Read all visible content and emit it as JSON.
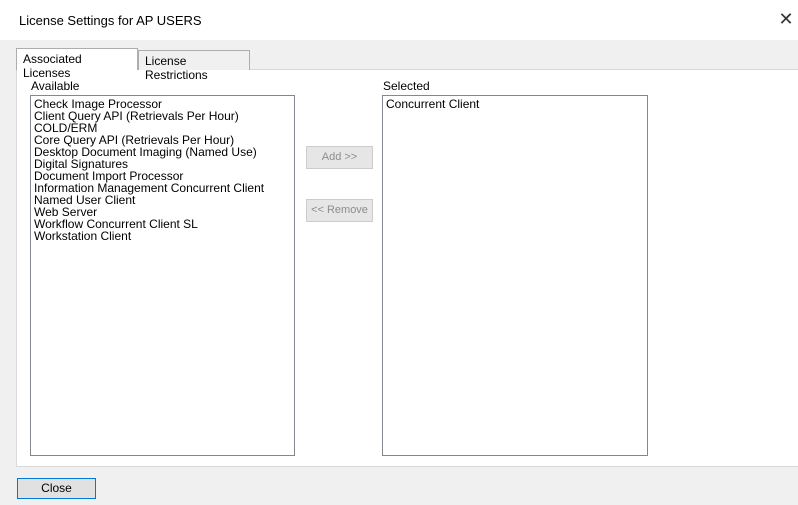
{
  "window": {
    "title": "License Settings for AP USERS",
    "close_glyph": "✕"
  },
  "tabs": [
    {
      "label": "Associated Licenses",
      "active": true
    },
    {
      "label": "License Restrictions",
      "active": false
    }
  ],
  "available": {
    "label": "Available",
    "items": [
      "Check Image Processor",
      "Client Query API (Retrievals Per Hour)",
      "COLD/ERM",
      "Core Query API (Retrievals Per Hour)",
      "Desktop Document Imaging (Named Use)",
      "Digital Signatures",
      "Document Import Processor",
      "Information Management Concurrent Client",
      "Named User Client",
      "Web Server",
      "Workflow Concurrent Client SL",
      "Workstation Client"
    ]
  },
  "selected": {
    "label": "Selected",
    "items": [
      "Concurrent Client"
    ]
  },
  "buttons": {
    "add_label": "Add >>",
    "remove_label": "<< Remove",
    "close_label": "Close"
  }
}
